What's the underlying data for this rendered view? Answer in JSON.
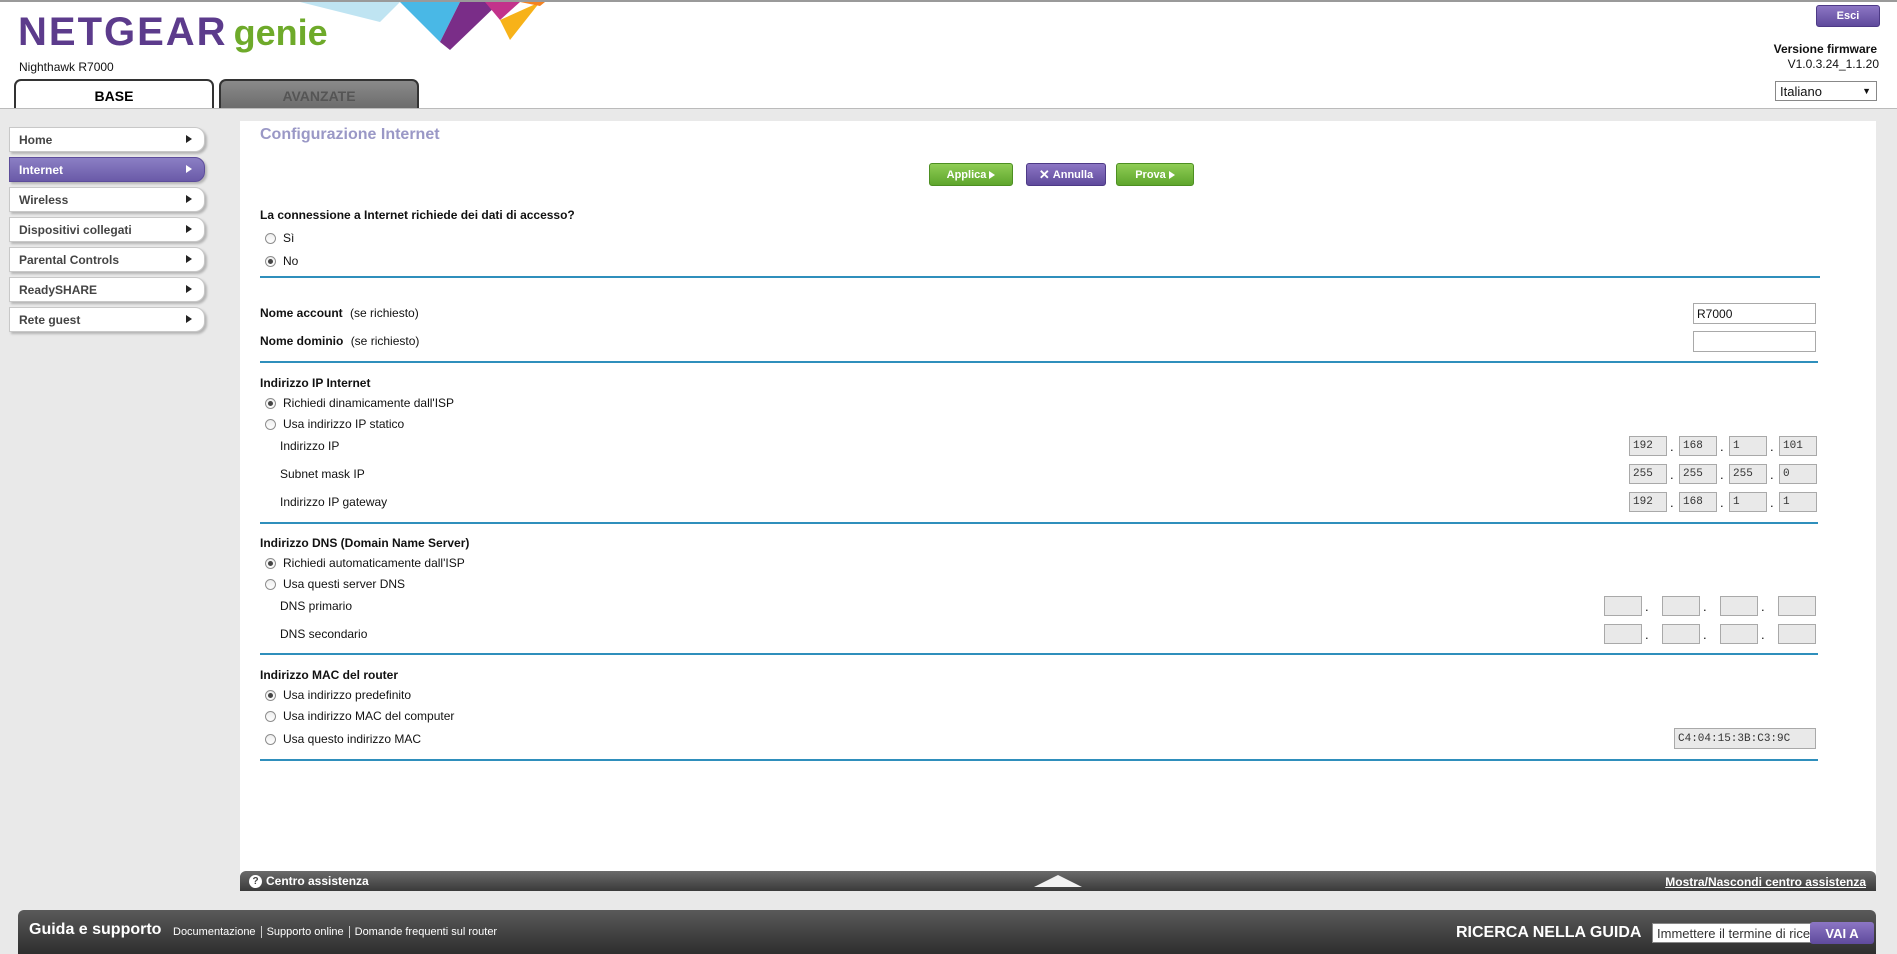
{
  "brand": {
    "name": "NETGEAR",
    "product": "genie",
    "model": "Nighthawk R7000"
  },
  "header": {
    "logout_label": "Esci",
    "firmware_label": "Versione firmware",
    "firmware_version": "V1.0.3.24_1.1.20",
    "language": "Italiano"
  },
  "tabs": {
    "base": "BASE",
    "advanced": "AVANZATE"
  },
  "sidebar": {
    "items": [
      {
        "label": "Home"
      },
      {
        "label": "Internet"
      },
      {
        "label": "Wireless"
      },
      {
        "label": "Dispositivi collegati"
      },
      {
        "label": "Parental Controls"
      },
      {
        "label": "ReadySHARE"
      },
      {
        "label": "Rete guest"
      }
    ],
    "active": "Internet"
  },
  "page": {
    "title": "Configurazione Internet"
  },
  "actions": {
    "apply": "Applica",
    "cancel": "Annulla",
    "test": "Prova"
  },
  "login_question": {
    "text": "La connessione a Internet richiede dei dati di accesso?",
    "yes": "Sì",
    "no": "No",
    "selected": "No"
  },
  "account": {
    "account_label": "Nome account",
    "domain_label": "Nome dominio",
    "optional_hint": "(se richiesto)",
    "account_value": "R7000",
    "domain_value": ""
  },
  "ip_section": {
    "title": "Indirizzo IP Internet",
    "dynamic": "Richiedi dinamicamente dall'ISP",
    "static": "Usa indirizzo IP statico",
    "selected": "dynamic",
    "ip_label": "Indirizzo IP",
    "subnet_label": "Subnet mask IP",
    "gateway_label": "Indirizzo IP gateway",
    "ip": [
      "192",
      "168",
      "1",
      "101"
    ],
    "subnet": [
      "255",
      "255",
      "255",
      "0"
    ],
    "gateway": [
      "192",
      "168",
      "1",
      "1"
    ]
  },
  "dns_section": {
    "title": "Indirizzo DNS (Domain Name Server)",
    "auto": "Richiedi automaticamente dall'ISP",
    "manual": "Usa questi server DNS",
    "selected": "auto",
    "primary_label": "DNS primario",
    "secondary_label": "DNS secondario",
    "primary": [
      "",
      "",
      "",
      ""
    ],
    "secondary": [
      "",
      "",
      "",
      ""
    ]
  },
  "mac_section": {
    "title": "Indirizzo MAC del router",
    "default": "Usa indirizzo predefinito",
    "computer": "Usa indirizzo MAC del computer",
    "custom": "Usa questo indirizzo MAC",
    "selected": "default",
    "mac_value": "C4:04:15:3B:C3:9C"
  },
  "help_bar": {
    "label": "Centro assistenza",
    "toggle": "Mostra/Nascondi centro assistenza"
  },
  "footer": {
    "title": "Guida e supporto",
    "links": [
      "Documentazione",
      "Supporto online",
      "Domande frequenti sul router"
    ],
    "search_title": "RICERCA NELLA GUIDA",
    "search_placeholder": "Immettere il termine di ricerca",
    "go_label": "VAI A"
  },
  "colors": {
    "brand_purple": "#5c3b8c",
    "brand_green": "#6eaa2a",
    "separator_blue": "#2f8fbc",
    "title_lavender": "#9a98c6"
  }
}
